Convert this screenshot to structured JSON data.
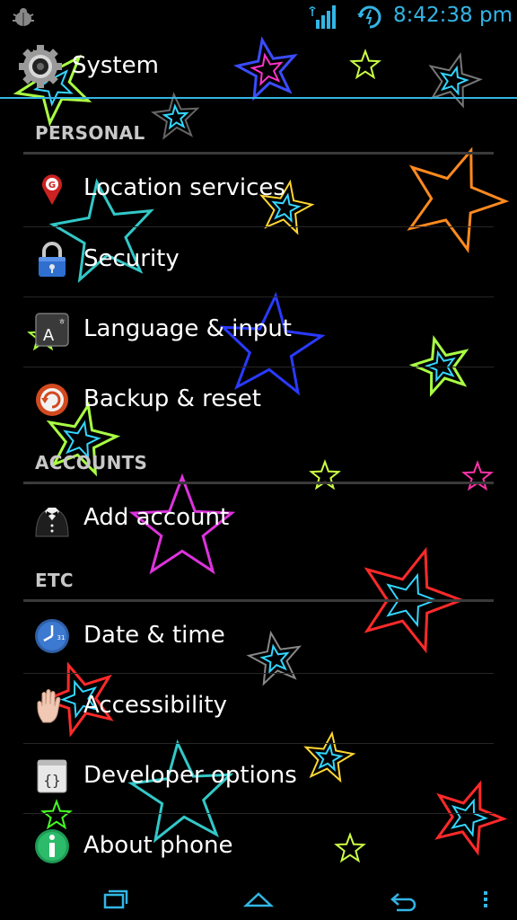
{
  "status_bar": {
    "time": "8:42:38 pm",
    "icons": [
      "debug-icon",
      "wifi-signal-icon",
      "sync-clock-icon"
    ],
    "accent_color": "#33b5e5"
  },
  "action_bar": {
    "title": "System",
    "icon": "settings-gear-icon",
    "accent_color": "#33b5e5"
  },
  "sections": [
    {
      "header": "PERSONAL",
      "items": [
        {
          "label": "Location services",
          "icon": "location-pin-icon"
        },
        {
          "label": "Security",
          "icon": "padlock-icon"
        },
        {
          "label": "Language & input",
          "icon": "keyboard-key-icon"
        },
        {
          "label": "Backup & reset",
          "icon": "backup-icon"
        }
      ]
    },
    {
      "header": "ACCOUNTS",
      "items": [
        {
          "label": "Add account",
          "icon": "tuxedo-icon"
        }
      ]
    },
    {
      "header": "ETC",
      "items": [
        {
          "label": "Date & time",
          "icon": "clock-icon"
        },
        {
          "label": "Accessibility",
          "icon": "hand-icon"
        },
        {
          "label": "Developer options",
          "icon": "braces-icon"
        },
        {
          "label": "About phone",
          "icon": "info-icon"
        }
      ]
    }
  ],
  "nav_bar": {
    "buttons": [
      "recent-apps-icon",
      "home-icon",
      "back-icon",
      "menu-icon"
    ]
  },
  "wallpaper": {
    "description_colors": [
      "#ff2a2a",
      "#3a6bff",
      "#ff33cc",
      "#ff8a1f",
      "#ffe633",
      "#8cff3a",
      "#33d6ff",
      "#888888"
    ]
  }
}
